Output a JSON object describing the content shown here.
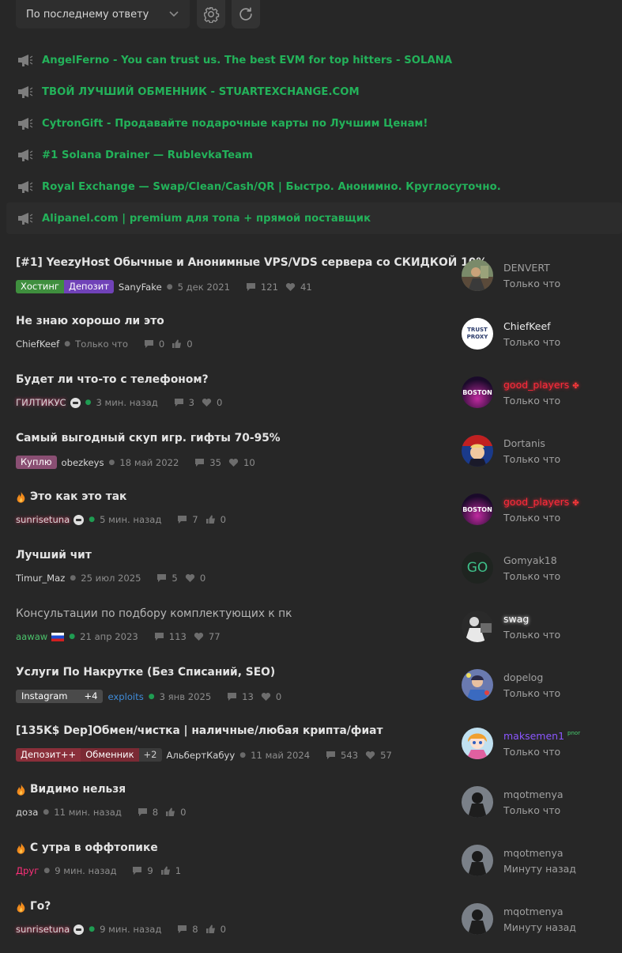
{
  "toolbar": {
    "sort_label": "По последнему ответу",
    "sort_icon": "chevron-down-icon",
    "settings_icon": "gear-icon",
    "refresh_icon": "refresh-icon"
  },
  "announcements": [
    {
      "text": "AngelFerno - You can trust us. The best EVM for top hitters - SOLANA"
    },
    {
      "text": "ТВОЙ ЛУЧШИЙ ОБМЕННИК - STUARTEXCHANGE.COM"
    },
    {
      "text": "CytronGift - Продавайте подарочные карты по Лучшим Ценам!"
    },
    {
      "text": "#1 Solana Drainer — RublevkaTeam"
    },
    {
      "text": "Royal Exchange — Swap/Clean/Cash/QR | Быстро. Анонимно. Круглосуточно."
    },
    {
      "text": "Alipanel.com | premium для топа + прямой поставщик"
    }
  ],
  "threads": [
    {
      "title": "[#1] YeezyHost Обычные и Анонимные VPS/VDS сервера со СКИДКОЙ 10%",
      "tags": [
        "Хостинг",
        "Депозит"
      ],
      "author": "SanyFake",
      "date": "5 дек 2021",
      "replies": "121",
      "likes": "41",
      "last_user": "DENVERT",
      "last_time": "Только что"
    },
    {
      "title": "Не знаю хорошо ли это",
      "author": "ChiefKeef",
      "date": "Только что",
      "replies": "0",
      "likes": "0",
      "last_user": "ChiefKeef",
      "last_time": "Только что",
      "avatar_text": "TRUST PROXY"
    },
    {
      "title": "Будет ли что-то с телефоном?",
      "author": "ГИЛТИКУС",
      "date": "3 мин. назад",
      "replies": "3",
      "likes": "0",
      "last_user": "good_players",
      "last_time": "Только что",
      "avatar_text": "BOSTON"
    },
    {
      "title": "Самый выгодный скуп игр. гифты 70-95%",
      "tags": [
        "Куплю"
      ],
      "author": "obezkeys",
      "date": "18 май 2022",
      "replies": "35",
      "likes": "10",
      "last_user": "Dortanis",
      "last_time": "Только что"
    },
    {
      "title": "Это как это так",
      "hot": true,
      "author": "sunrisetuna",
      "date": "5 мин. назад",
      "replies": "7",
      "likes": "0",
      "last_user": "good_players",
      "last_time": "Только что",
      "avatar_text": "BOSTON"
    },
    {
      "title": "Лучший чит",
      "author": "Timur_Maz",
      "date": "25 июл 2025",
      "replies": "5",
      "likes": "0",
      "last_user": "Gomyak18",
      "last_time": "Только что",
      "avatar_text": "GO"
    },
    {
      "title": "Консультации по подбору комплектующих к пк",
      "author": "aawaw",
      "date": "21 апр 2023",
      "replies": "113",
      "likes": "77",
      "last_user": "swag",
      "last_time": "Только что"
    },
    {
      "title": "Услуги По Накрутке (Без Списаний, SEO)",
      "tags": [
        "Instagram",
        "+4"
      ],
      "author": "exploits",
      "date": "3 янв 2025",
      "replies": "13",
      "likes": "0",
      "last_user": "dopelog",
      "last_time": "Только что"
    },
    {
      "title": "[135K$ Dep]Обмен/чистка | наличные/любая крипта/фиат",
      "tags": [
        "Депозит++",
        "Обменник",
        "+2"
      ],
      "author": "АльбертКабуу",
      "date": "11 май 2024",
      "replies": "543",
      "likes": "57",
      "last_user": "maksemen1",
      "last_user_tag": "pnor",
      "last_time": "Только что"
    },
    {
      "title": "Видимо нельзя",
      "hot": true,
      "author": "доза",
      "date": "11 мин. назад",
      "replies": "8",
      "likes": "0",
      "last_user": "mqotmenya",
      "last_time": "Только что"
    },
    {
      "title": "С утра в оффтопике",
      "hot": true,
      "author": "Друг",
      "date": "9 мин. назад",
      "replies": "9",
      "likes": "1",
      "last_user": "mqotmenya",
      "last_time": "Минуту назад"
    },
    {
      "title": "Го?",
      "hot": true,
      "author": "sunrisetuna",
      "date": "9 мин. назад",
      "replies": "8",
      "likes": "0",
      "last_user": "mqotmenya",
      "last_time": "Минуту назад"
    }
  ],
  "colors": {
    "background": "#272727",
    "accent_green": "#23b25a",
    "text": "#e3e3e3"
  }
}
